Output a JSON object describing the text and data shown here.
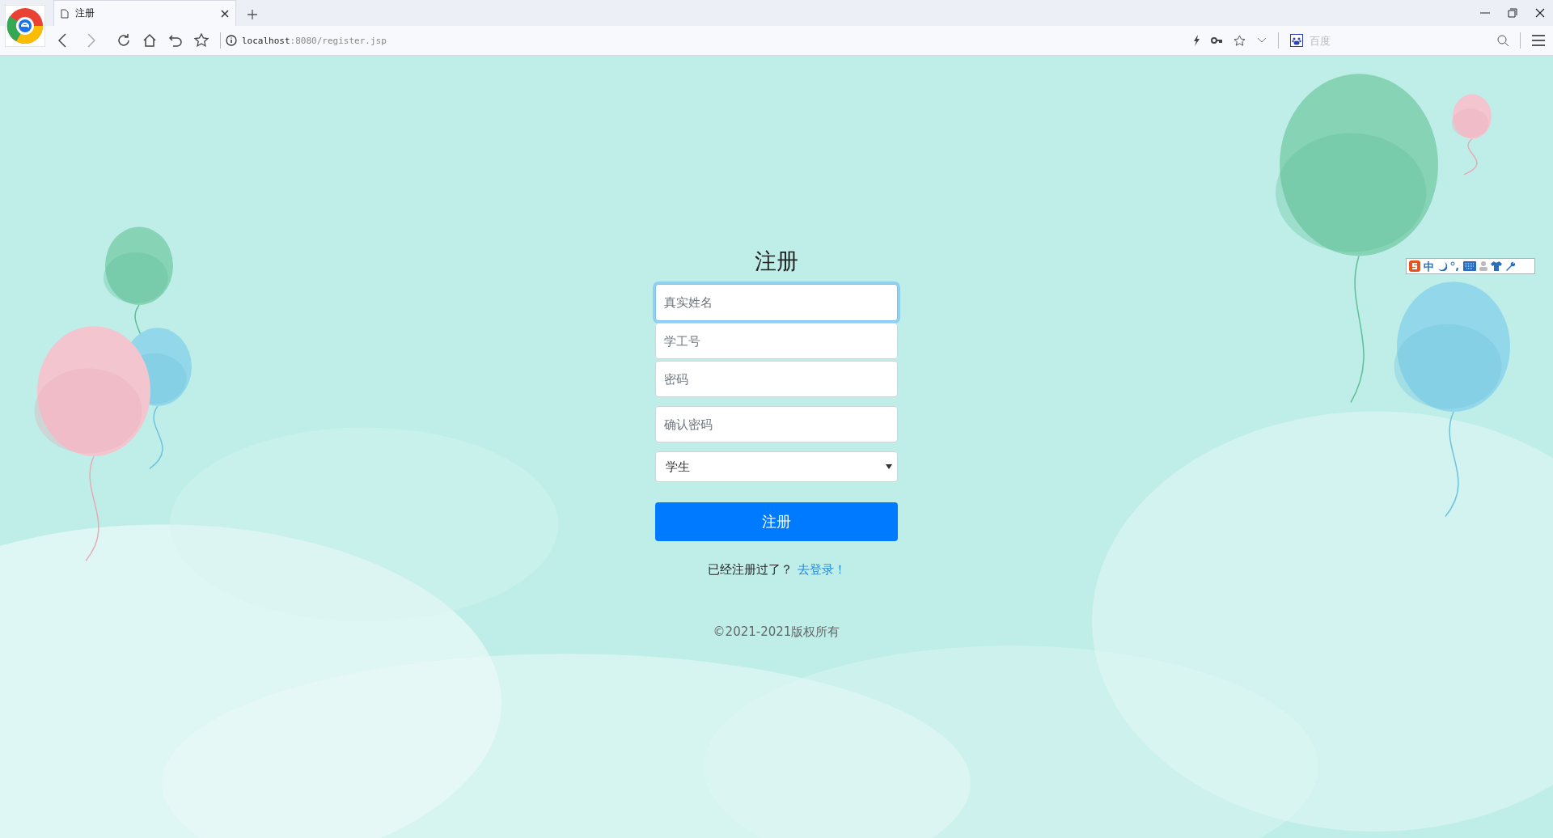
{
  "browser": {
    "tab": {
      "title": "注册"
    },
    "address_host": "localhost",
    "address_rest": ":8080/register.jsp",
    "search": {
      "placeholder": "百度"
    }
  },
  "form": {
    "title": "注册",
    "fields": [
      {
        "placeholder": "真实姓名",
        "focused": true
      },
      {
        "placeholder": "学工号",
        "focused": false
      },
      {
        "placeholder": "密码",
        "focused": false
      },
      {
        "placeholder": "确认密码",
        "focused": false
      }
    ],
    "role_select": {
      "value": "学生"
    },
    "submit": "注册",
    "login_prompt": "已经注册过了？",
    "login_link": "去登录！"
  },
  "footer": {
    "copyright": "©2021-2021版权所有"
  },
  "ime_toolbar": {
    "mode": "中"
  }
}
